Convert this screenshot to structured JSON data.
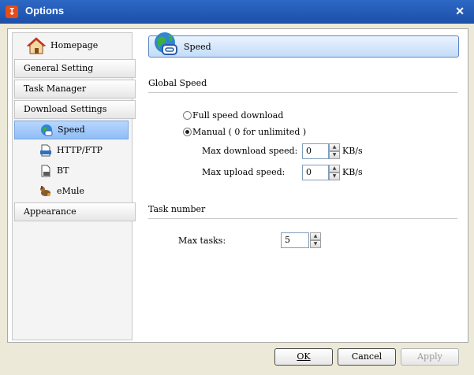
{
  "window": {
    "title": "Options",
    "close_glyph": "✕",
    "app_icon_glyph": "↧"
  },
  "sidebar": {
    "homepage": "Homepage",
    "general_setting": "General Setting",
    "task_manager": "Task Manager",
    "download_settings": "Download Settings",
    "sub_items": [
      "Speed",
      "HTTP/FTP",
      "BT",
      "eMule"
    ],
    "appearance": "Appearance"
  },
  "header": {
    "label": "Speed"
  },
  "global_speed": {
    "heading": "Global Speed",
    "full_speed_label": "Full speed download",
    "manual_label": "Manual ( 0 for unlimited )",
    "selected": "manual",
    "max_download_label": "Max download speed:",
    "max_download_value": "0",
    "max_upload_label": "Max upload speed:",
    "max_upload_value": "0",
    "unit": "KB/s"
  },
  "task_number": {
    "heading": "Task number",
    "max_tasks_label": "Max tasks:",
    "max_tasks_value": "5"
  },
  "buttons": {
    "ok": "OK",
    "cancel": "Cancel",
    "apply": "Apply"
  },
  "colors": {
    "titlebar": "#2d68c6",
    "dialog_bg": "#ece9d8",
    "selected_item": "#b9d7ff"
  }
}
